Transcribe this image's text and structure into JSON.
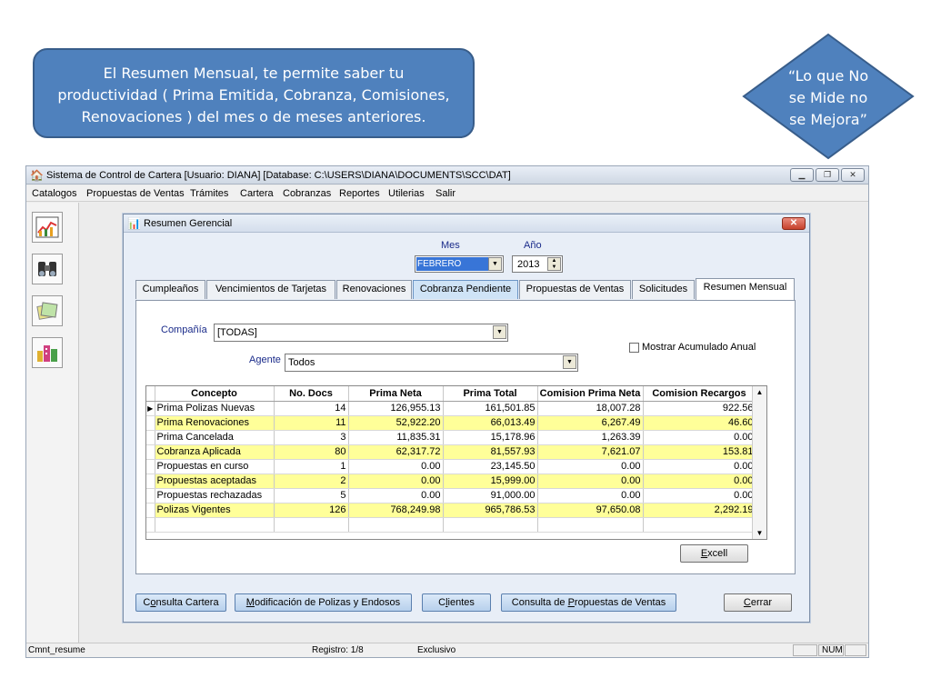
{
  "callout": {
    "line1": "El Resumen Mensual, te permite saber tu",
    "line2": "productividad ( Prima Emitida, Cobranza, Comisiones,",
    "line3": "Renovaciones ) del mes o de meses anteriores."
  },
  "quote": {
    "line1": "“Lo que No",
    "line2": "se Mide no",
    "line3": "se Mejora”"
  },
  "colors": {
    "callout": "#4f81bd",
    "row_highlight": "#ffff99",
    "tab_highlight": "#cfe3f6"
  },
  "window": {
    "title": "Sistema de Control de Cartera   [Usuario: DIANA]   [Database: C:\\USERS\\DIANA\\DOCUMENTS\\SCC\\DAT]",
    "minimize": "▁",
    "maximize": "❐",
    "close": "✕"
  },
  "menu": {
    "catalogos": "Catalogos",
    "propuestas": "Propuestas de Ventas",
    "tramites": "Trámites",
    "cartera": "Cartera",
    "cobranzas": "Cobranzas",
    "reportes": "Reportes",
    "utilerias": "Utilerias",
    "salir": "Salir"
  },
  "toolbar_icons": [
    "chart-icon",
    "binoculars-icon",
    "documents-icon",
    "buildings-icon"
  ],
  "child": {
    "title": "Resumen Gerencial",
    "close": "✕",
    "mes_label": "Mes",
    "anio_label": "Año",
    "mes_value": "FEBRERO",
    "anio_value": "2013"
  },
  "tabs": {
    "t1": "Cumpleaños",
    "t2": "Vencimientos de Tarjetas",
    "t3": "Renovaciones",
    "t4": "Cobranza Pendiente",
    "t5": "Propuestas de Ventas",
    "t6": "Solicitudes",
    "t7": "Resumen Mensual"
  },
  "panel": {
    "compania_label": "Compañía",
    "compania_value": "[TODAS]",
    "agente_label": "Agente",
    "agente_value": "Todos",
    "acumulado_label": "Mostrar Acumulado Anual"
  },
  "table": {
    "headers": {
      "concepto": "Concepto",
      "docs": "No. Docs",
      "neta": "Prima Neta",
      "total": "Prima Total",
      "com_neta": "Comision Prima Neta",
      "com_rec": "Comision Recargos"
    },
    "rows": [
      [
        "Prima Polizas Nuevas",
        "14",
        "126,955.13",
        "161,501.85",
        "18,007.28",
        "922.56"
      ],
      [
        "Prima Renovaciones",
        "11",
        "52,922.20",
        "66,013.49",
        "6,267.49",
        "46.60"
      ],
      [
        "Prima Cancelada",
        "3",
        "11,835.31",
        "15,178.96",
        "1,263.39",
        "0.00"
      ],
      [
        "Cobranza Aplicada",
        "80",
        "62,317.72",
        "81,557.93",
        "7,621.07",
        "153.81"
      ],
      [
        "Propuestas en curso",
        "1",
        "0.00",
        "23,145.50",
        "0.00",
        "0.00"
      ],
      [
        "Propuestas aceptadas",
        "2",
        "0.00",
        "15,999.00",
        "0.00",
        "0.00"
      ],
      [
        "Propuestas rechazadas",
        "5",
        "0.00",
        "91,000.00",
        "0.00",
        "0.00"
      ],
      [
        "Polizas Vigentes",
        "126",
        "768,249.98",
        "965,786.53",
        "97,650.08",
        "2,292.19"
      ]
    ]
  },
  "buttons": {
    "excel_first": "E",
    "excel_rest": "xcell",
    "consulta_cartera_pre": "C",
    "consulta_cartera_u": "o",
    "consulta_cartera_post": "nsulta Cartera",
    "modif_u": "M",
    "modif_post": "odificación de Polizas y Endosos",
    "clientes_pre": "C",
    "clientes_u": "l",
    "clientes_post": "ientes",
    "propuestas_pre": "Consulta de ",
    "propuestas_u": "P",
    "propuestas_post": "ropuestas de Ventas",
    "cerrar_u": "C",
    "cerrar_post": "errar"
  },
  "status": {
    "form": "Cmnt_resume",
    "registro": "Registro: 1/8",
    "exclusivo": "Exclusivo",
    "num": "NUM"
  }
}
